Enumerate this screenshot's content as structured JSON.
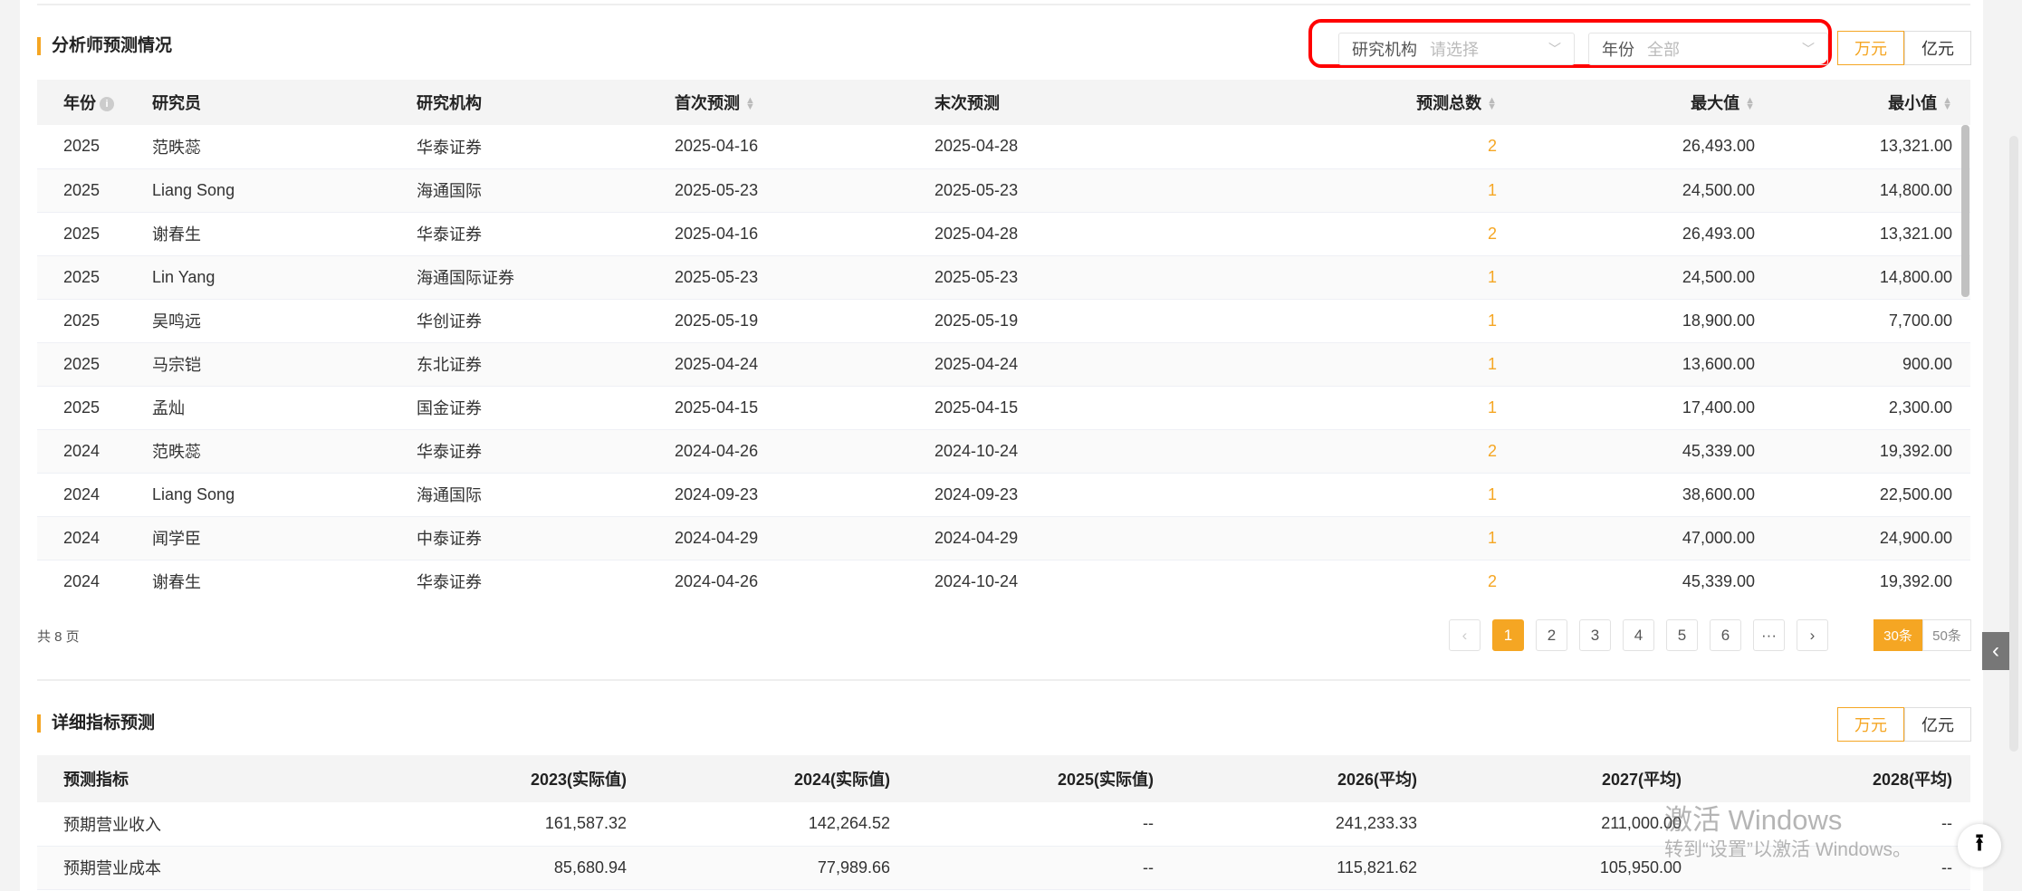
{
  "section1": {
    "title": "分析师预测情况",
    "filters": {
      "institution": {
        "label": "研究机构",
        "placeholder": "请选择"
      },
      "year": {
        "label": "年份",
        "value": "全部"
      }
    },
    "units": [
      "万元",
      "亿元"
    ],
    "columns": [
      "年份",
      "研究员",
      "研究机构",
      "首次预测",
      "末次预测",
      "预测总数",
      "最大值",
      "最小值"
    ],
    "rows": [
      [
        "2025",
        "范昳蕊",
        "华泰证券",
        "2025-04-16",
        "2025-04-28",
        "2",
        "26,493.00",
        "13,321.00"
      ],
      [
        "2025",
        "Liang Song",
        "海通国际",
        "2025-05-23",
        "2025-05-23",
        "1",
        "24,500.00",
        "14,800.00"
      ],
      [
        "2025",
        "谢春生",
        "华泰证券",
        "2025-04-16",
        "2025-04-28",
        "2",
        "26,493.00",
        "13,321.00"
      ],
      [
        "2025",
        "Lin Yang",
        "海通国际证券",
        "2025-05-23",
        "2025-05-23",
        "1",
        "24,500.00",
        "14,800.00"
      ],
      [
        "2025",
        "吴鸣远",
        "华创证券",
        "2025-05-19",
        "2025-05-19",
        "1",
        "18,900.00",
        "7,700.00"
      ],
      [
        "2025",
        "马宗铠",
        "东北证券",
        "2025-04-24",
        "2025-04-24",
        "1",
        "13,600.00",
        "900.00"
      ],
      [
        "2025",
        "孟灿",
        "国金证券",
        "2025-04-15",
        "2025-04-15",
        "1",
        "17,400.00",
        "2,300.00"
      ],
      [
        "2024",
        "范昳蕊",
        "华泰证券",
        "2024-04-26",
        "2024-10-24",
        "2",
        "45,339.00",
        "19,392.00"
      ],
      [
        "2024",
        "Liang Song",
        "海通国际",
        "2024-09-23",
        "2024-09-23",
        "1",
        "38,600.00",
        "22,500.00"
      ],
      [
        "2024",
        "闻学臣",
        "中泰证券",
        "2024-04-29",
        "2024-04-29",
        "1",
        "47,000.00",
        "24,900.00"
      ],
      [
        "2024",
        "谢春生",
        "华泰证券",
        "2024-04-26",
        "2024-10-24",
        "2",
        "45,339.00",
        "19,392.00"
      ]
    ],
    "pagination": {
      "total": "共 8 页",
      "prev": "‹",
      "pages": [
        "1",
        "2",
        "3",
        "4",
        "5",
        "6",
        "···"
      ],
      "next": "›",
      "sizes": [
        "30条",
        "50条"
      ]
    }
  },
  "section2": {
    "title": "详细指标预测",
    "units": [
      "万元",
      "亿元"
    ],
    "columns": [
      "预测指标",
      "2023(实际值)",
      "2024(实际值)",
      "2025(实际值)",
      "2026(平均)",
      "2027(平均)",
      "2028(平均)"
    ],
    "rows": [
      [
        "预期营业收入",
        "161,587.32",
        "142,264.52",
        "--",
        "241,233.33",
        "211,000.00",
        "--"
      ],
      [
        "预期营业成本",
        "85,680.94",
        "77,989.66",
        "--",
        "115,821.62",
        "105,950.00",
        "--"
      ]
    ]
  },
  "watermark": {
    "line1": "激活 Windows",
    "line2": "转到“设置”以激活 Windows。"
  },
  "icons": {
    "side_tab": "‹",
    "to_top": "⭱"
  }
}
